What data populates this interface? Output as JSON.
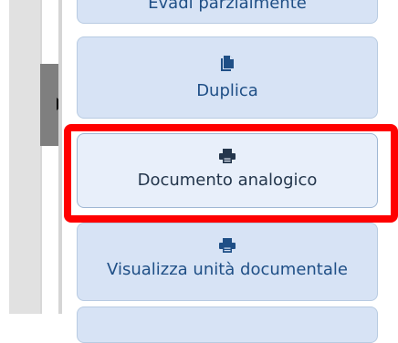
{
  "sidebar": {
    "collapse_toggle_icon": "caret-right-icon"
  },
  "actions": {
    "partial_label": "Evadi parzialmente",
    "duplica": {
      "label": "Duplica",
      "icon": "copy-file-icon"
    },
    "documento_analogico": {
      "label": "Documento analogico",
      "icon": "printer-icon"
    },
    "visualizza": {
      "label": "Visualizza unità documentale",
      "icon": "printer-icon"
    }
  },
  "highlight": {
    "color": "#ff0000",
    "target": "Documento analogico"
  },
  "colors": {
    "button_bg": "#d7e3f5",
    "button_text": "#1f4f86",
    "button_border": "#b8cbe2"
  }
}
